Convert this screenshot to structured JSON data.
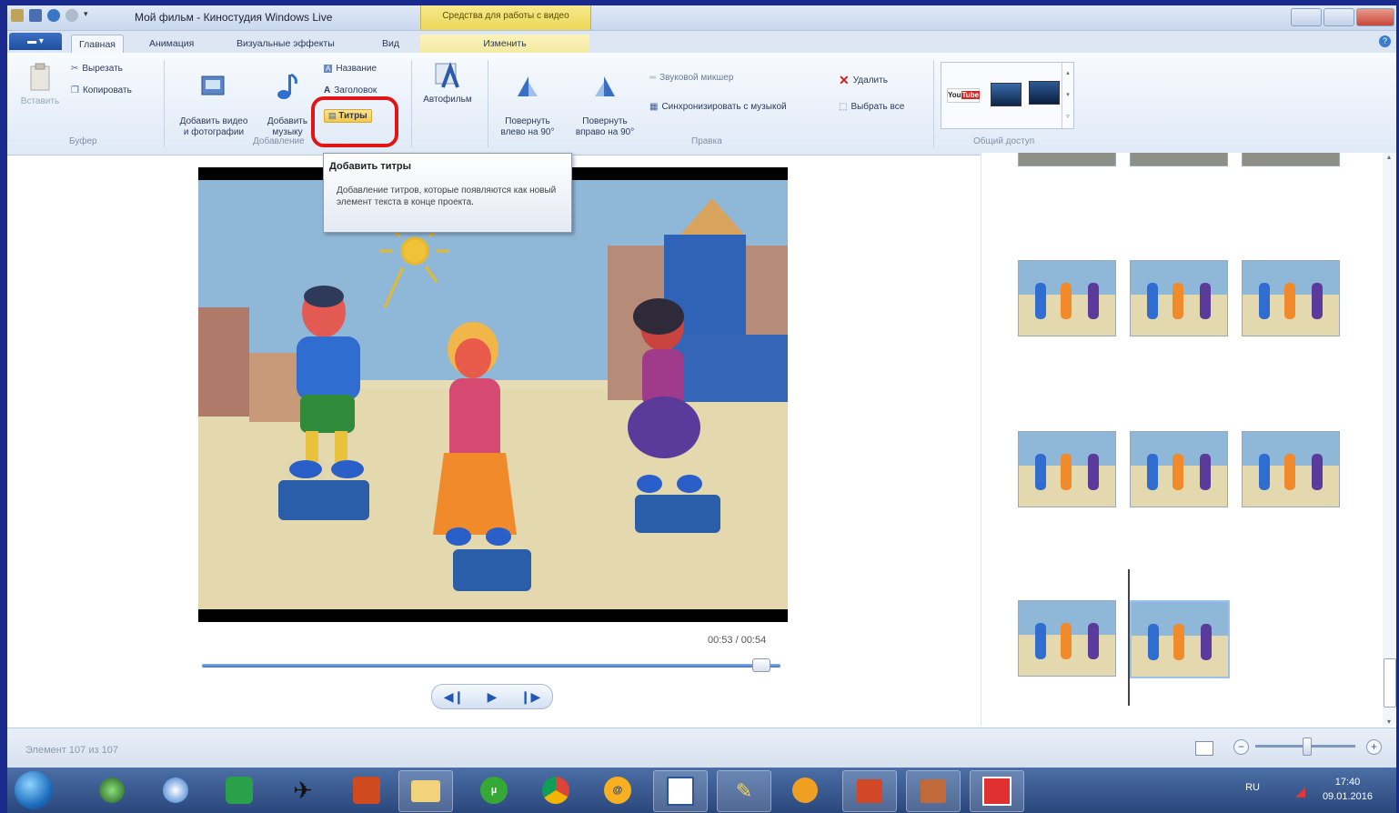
{
  "window": {
    "title": "Мой фильм - Киностудия Windows Live",
    "context_tools": "Средства для работы с видео"
  },
  "tabs": [
    {
      "label": "Главная",
      "active": true
    },
    {
      "label": "Анимация",
      "active": false
    },
    {
      "label": "Визуальные эффекты",
      "active": false
    },
    {
      "label": "Вид",
      "active": false
    },
    {
      "label": "Изменить",
      "active": false
    }
  ],
  "ribbon": {
    "clipboard": {
      "paste": "Вставить",
      "cut": "Вырезать",
      "copy": "Копировать",
      "group_label": "Буфер"
    },
    "add": {
      "add_video": "Добавить видео\nи фотографии",
      "add_music": "Добавить\nмузыку",
      "title": "Название",
      "caption": "Заголовок",
      "credits": "Титры",
      "group_label": "Добавление"
    },
    "automovie": "Автофильм",
    "edit": {
      "rotate_left": "Повернуть\nвлево на 90°",
      "rotate_right": "Повернуть\nвправо на 90°",
      "audio_mixer": "Звуковой микшер",
      "sync_music": "Синхронизировать с музыкой",
      "delete": "Удалить",
      "select_all": "Выбрать все",
      "group_label": "Правка"
    },
    "share": {
      "group_label": "Общий доступ"
    }
  },
  "tooltip": {
    "title": "Добавить титры",
    "body": "Добавление титров, которые появляются как новый элемент текста в конце проекта."
  },
  "preview": {
    "timecode": "00:53 / 00:54",
    "progress": 0.98
  },
  "status": {
    "text": "Элемент 107 из 107"
  },
  "taskbar": {
    "lang": "RU",
    "time": "17:40",
    "date": "09.01.2016"
  },
  "colors": {
    "accent": "#3c74c2",
    "highlight": "#e01515",
    "desktop": "#1a2a8c"
  }
}
